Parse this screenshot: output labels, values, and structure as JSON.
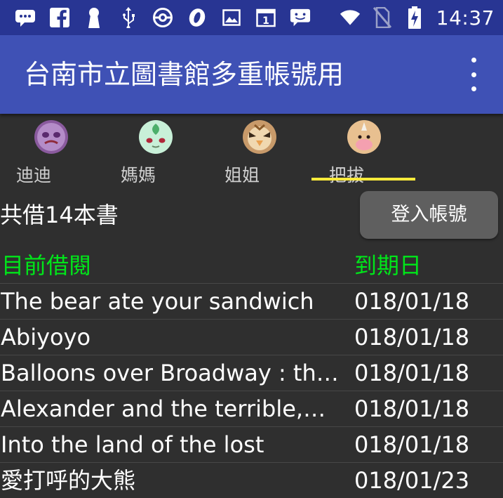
{
  "status_bar": {
    "time": "14:37",
    "icons": [
      "message-icon",
      "facebook-icon",
      "keyhole-icon",
      "usb-icon",
      "pokeball-icon",
      "opera-icon",
      "image-icon",
      "calendar-icon",
      "chat-icon",
      "wifi-icon",
      "no-sim-icon",
      "battery-charging-icon"
    ],
    "calendar_day": "1"
  },
  "app_bar": {
    "title": "台南市立圖書館多重帳號用",
    "menu_icon": "more-vert-icon"
  },
  "tabs": [
    {
      "label": "迪迪",
      "avatar_icon": "purple-pokemon-avatar",
      "selected": false
    },
    {
      "label": "媽媽",
      "avatar_icon": "green-pokemon-avatar",
      "selected": false
    },
    {
      "label": "姐姐",
      "avatar_icon": "pidgey-avatar",
      "selected": false
    },
    {
      "label": "把拔",
      "avatar_icon": "weedle-avatar",
      "selected": true
    }
  ],
  "accent_color": "#ffeb3b",
  "header_color": "#00e61a",
  "summary": {
    "text": "共借14本書",
    "login_button": "登入帳號"
  },
  "table": {
    "columns": [
      "目前借閱",
      "到期日"
    ],
    "rows": [
      {
        "title": "The bear ate your sandwich",
        "due": "018/01/18"
      },
      {
        "title": "Abiyoyo",
        "due": "018/01/18"
      },
      {
        "title": "Balloons over Broadway : the…",
        "due": "018/01/18"
      },
      {
        "title": "Alexander and the terrible,…",
        "due": "018/01/18"
      },
      {
        "title": "Into the land of the lost",
        "due": "018/01/18"
      },
      {
        "title": "愛打呼的大熊",
        "due": "018/01/23"
      }
    ]
  }
}
